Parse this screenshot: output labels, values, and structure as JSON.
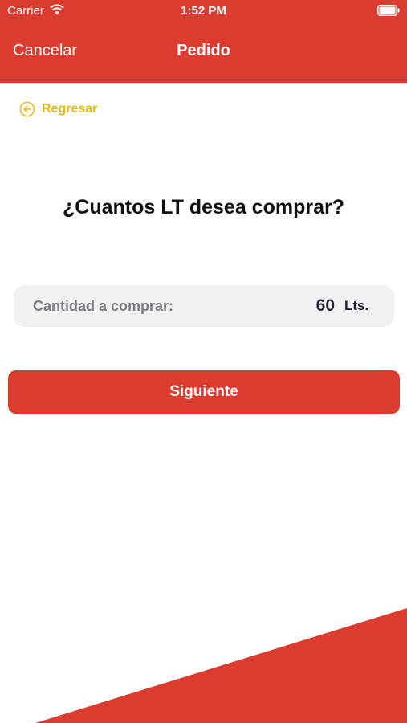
{
  "status_bar": {
    "carrier": "Carrier",
    "time": "1:52 PM"
  },
  "nav": {
    "cancel_label": "Cancelar",
    "title": "Pedido"
  },
  "back": {
    "label": "Regresar"
  },
  "question": "¿Cuantos LT desea comprar?",
  "quantity": {
    "label": "Cantidad a comprar:",
    "value": "60",
    "unit": "Lts."
  },
  "next_button_label": "Siguiente",
  "colors": {
    "brand_red": "#dc3c30",
    "back_yellow": "#e8b814",
    "field_bg": "#f1f1f3"
  }
}
